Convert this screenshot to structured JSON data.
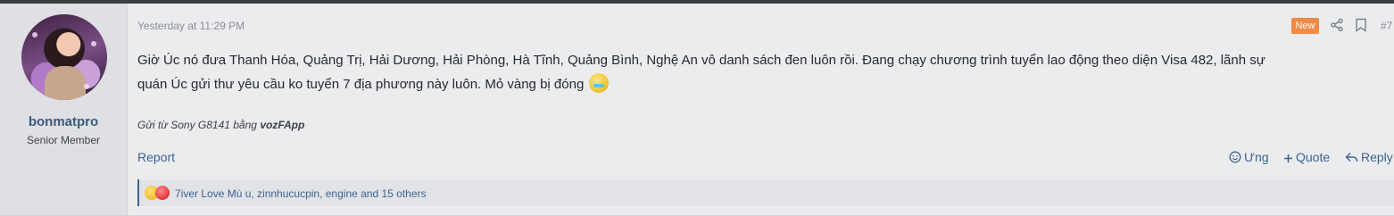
{
  "post": {
    "timestamp": "Yesterday at 11:29 PM",
    "badge": "New",
    "post_number": "#7",
    "message_line1": "Giờ Úc nó đưa Thanh Hóa, Quảng Trị, Hải Dương, Hải Phòng, Hà Tĩnh, Quảng Bình, Nghệ An vô danh sách đen luôn rồi. Đang chạy chương trình tuyển lao động theo diện Visa 482, lãnh sự",
    "message_line2": "quán Úc gửi thư yêu cầu ko tuyển 7 địa phương này luôn. Mỏ vàng bị đóng",
    "signature_prefix": "Gửi từ Sony G8141 bằng",
    "signature_app": "vozFApp",
    "message_emoji": "tearful-face-emoji"
  },
  "user": {
    "name": "bonmatpro",
    "title": "Senior Member"
  },
  "actions": {
    "report": "Report",
    "ung": "Ưng",
    "quote": "Quote",
    "reply": "Reply"
  },
  "reactions": {
    "text": "7iver Love Mù u, zinnhucucpin, engine and 15 others",
    "icons": [
      "heart-eyes-icon",
      "love-face-icon"
    ]
  },
  "colors": {
    "accent": "#3d6391",
    "username": "#3a5a80",
    "badge": "#f08a45"
  }
}
